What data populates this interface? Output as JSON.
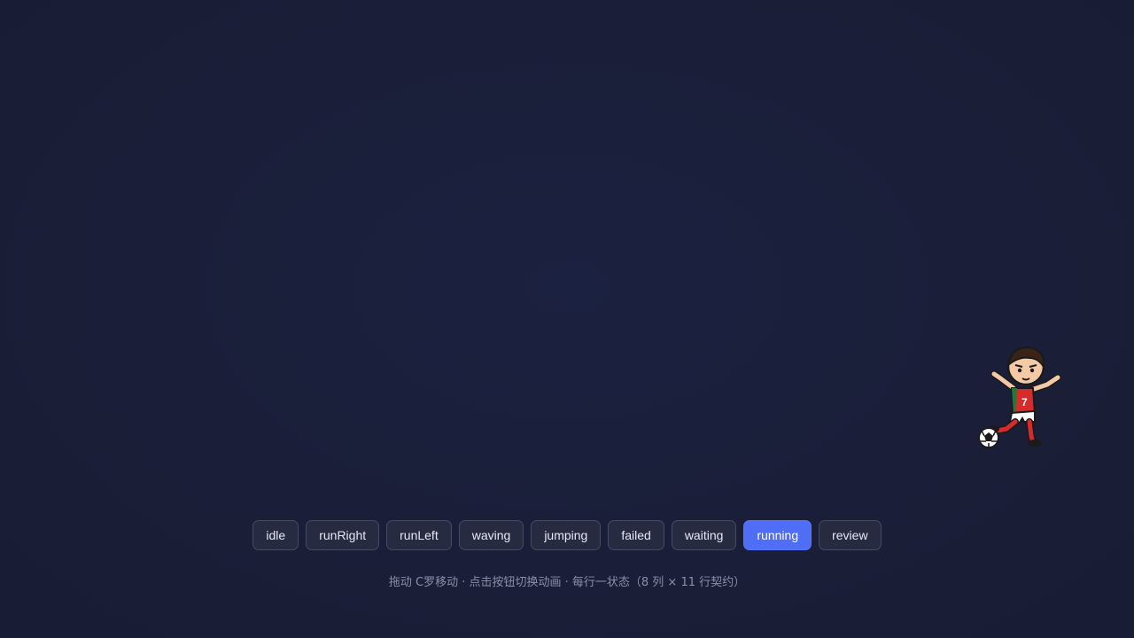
{
  "buttons": [
    {
      "id": "idle",
      "label": "idle",
      "active": false
    },
    {
      "id": "runRight",
      "label": "runRight",
      "active": false
    },
    {
      "id": "runLeft",
      "label": "runLeft",
      "active": false
    },
    {
      "id": "waving",
      "label": "waving",
      "active": false
    },
    {
      "id": "jumping",
      "label": "jumping",
      "active": false
    },
    {
      "id": "failed",
      "label": "failed",
      "active": false
    },
    {
      "id": "waiting",
      "label": "waiting",
      "active": false
    },
    {
      "id": "running",
      "label": "running",
      "active": true
    },
    {
      "id": "review",
      "label": "review",
      "active": false
    }
  ],
  "hint": "拖动 C罗移动 · 点击按钮切换动画 · 每行一状态（8 列 × 11 行契约）",
  "sprite": {
    "jersey_number": "7",
    "icon": "soccer-player-sprite"
  },
  "colors": {
    "background": "#1a1e38",
    "accent": "#4f6df5",
    "button_bg": "#262b42",
    "button_border": "#454b63"
  }
}
